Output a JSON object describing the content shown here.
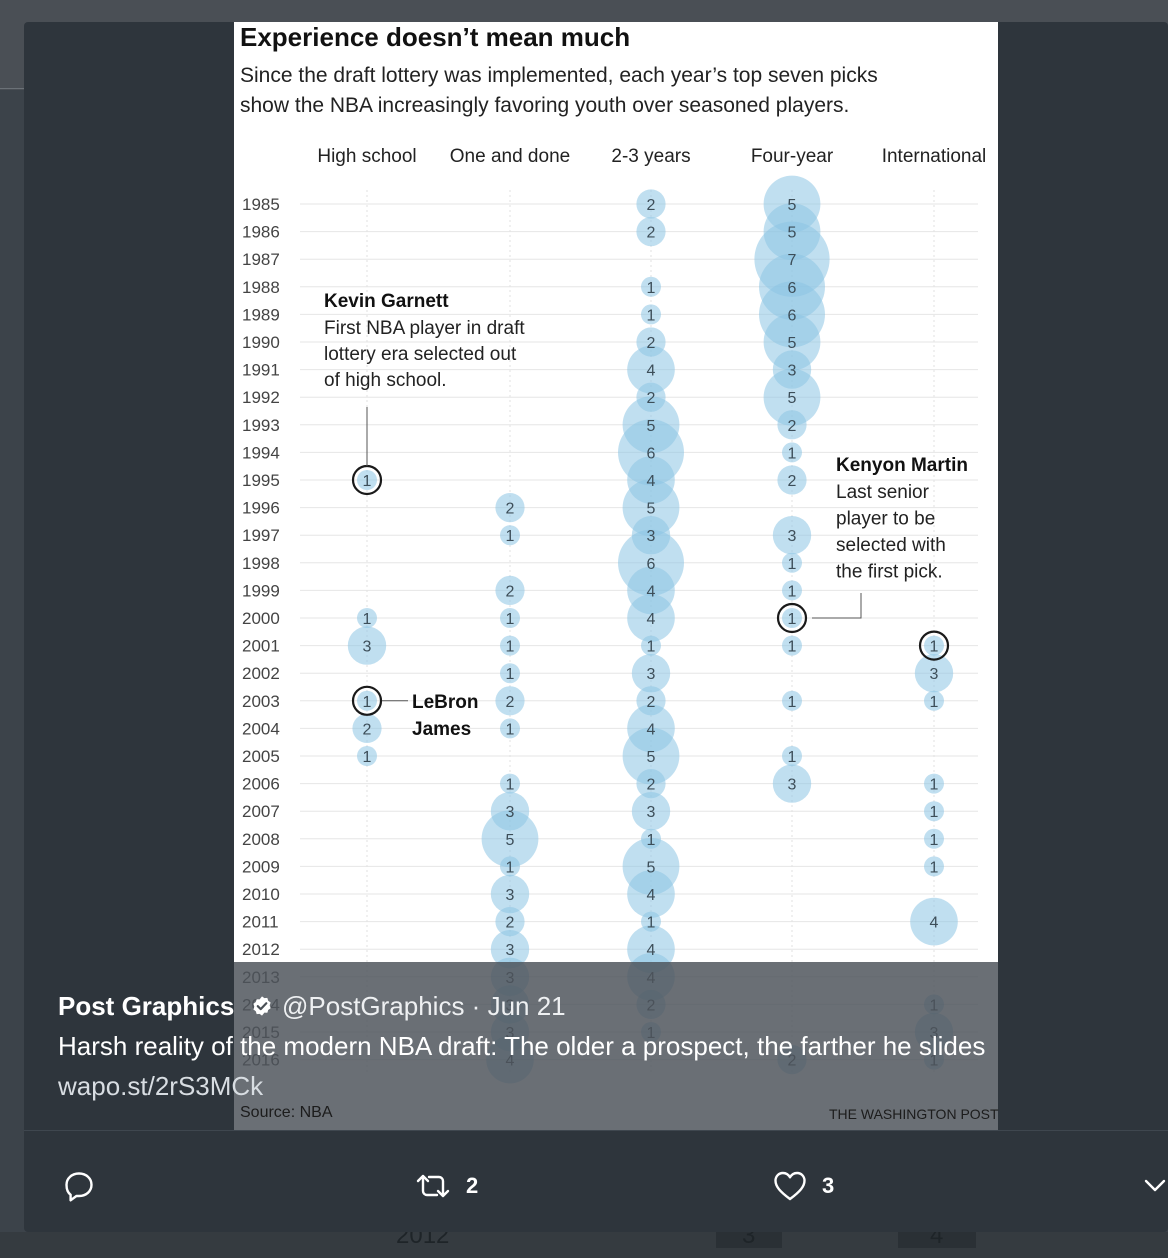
{
  "graphic": {
    "title": "Experience doesn’t mean much",
    "subtitle_line1": "Since the draft lottery was implemented, each year’s top seven picks",
    "subtitle_line2": "show the NBA increasingly favoring youth over seasoned players.",
    "source": "Source: NBA",
    "credit": "THE WASHINGTON POST"
  },
  "chart_data": {
    "type": "scatter",
    "title": "Experience doesn’t mean much",
    "subtitle": "Since the draft lottery was implemented, each year’s top seven picks show the NBA increasingly favoring youth over seasoned players.",
    "categories": [
      "High school",
      "One and done",
      "2-3 years",
      "Four-year",
      "International"
    ],
    "years": [
      1985,
      1986,
      1987,
      1988,
      1989,
      1990,
      1991,
      1992,
      1993,
      1994,
      1995,
      1996,
      1997,
      1998,
      1999,
      2000,
      2001,
      2002,
      2003,
      2004,
      2005,
      2006,
      2007,
      2008,
      2009,
      2010,
      2011,
      2012,
      2013,
      2014,
      2015,
      2016
    ],
    "series": [
      {
        "name": "High school",
        "values": [
          0,
          0,
          0,
          0,
          0,
          0,
          0,
          0,
          0,
          0,
          1,
          0,
          0,
          0,
          0,
          1,
          3,
          0,
          1,
          2,
          1,
          0,
          0,
          0,
          0,
          0,
          0,
          0,
          0,
          0,
          0,
          0
        ]
      },
      {
        "name": "One and done",
        "values": [
          0,
          0,
          0,
          0,
          0,
          0,
          0,
          0,
          0,
          0,
          0,
          2,
          1,
          0,
          2,
          1,
          1,
          1,
          2,
          1,
          0,
          1,
          3,
          5,
          1,
          3,
          2,
          3,
          3,
          3,
          3,
          4
        ]
      },
      {
        "name": "2-3 years",
        "values": [
          2,
          2,
          0,
          1,
          1,
          2,
          4,
          2,
          5,
          6,
          4,
          5,
          3,
          6,
          4,
          4,
          1,
          3,
          2,
          4,
          5,
          2,
          3,
          1,
          5,
          4,
          1,
          4,
          4,
          2,
          1,
          0
        ]
      },
      {
        "name": "Four-year",
        "values": [
          5,
          5,
          7,
          6,
          6,
          5,
          3,
          5,
          2,
          1,
          2,
          0,
          3,
          1,
          1,
          1,
          1,
          0,
          1,
          0,
          1,
          3,
          0,
          0,
          0,
          0,
          0,
          0,
          0,
          0,
          0,
          2
        ]
      },
      {
        "name": "International",
        "values": [
          0,
          0,
          0,
          0,
          0,
          0,
          0,
          0,
          0,
          0,
          0,
          0,
          0,
          0,
          0,
          0,
          1,
          3,
          1,
          0,
          0,
          1,
          1,
          1,
          1,
          0,
          4,
          0,
          0,
          1,
          3,
          1
        ]
      }
    ],
    "highlights": [
      {
        "column": "High school",
        "year": 1995,
        "value": 1
      },
      {
        "column": "High school",
        "year": 2003,
        "value": 1
      },
      {
        "column": "Four-year",
        "year": 2000,
        "value": 1
      },
      {
        "column": "International",
        "year": 2001,
        "value": 1
      }
    ],
    "annotations": [
      {
        "title": "Kevin Garnett",
        "lines": [
          "First NBA player in draft",
          "lottery era selected out",
          "of high school."
        ]
      },
      {
        "title_lines": [
          "LeBron",
          "James"
        ]
      },
      {
        "title": "Kenyon Martin",
        "lines": [
          "Last senior",
          "player to be",
          "selected with",
          "the first pick."
        ]
      }
    ],
    "colors": {
      "bubble": "#8cc4e3",
      "number": "#3d4e59",
      "highlight_ring": "#1a1a1a",
      "gridline": "#e6e6e6"
    }
  },
  "tweet": {
    "author_name": "Post Graphics",
    "handle_line": "@PostGraphics · Jun 21",
    "text": "Harsh reality of the modern NBA draft: The older a prospect, the farther he slides",
    "link": "wapo.st/2rS3MCk"
  },
  "actions": {
    "retweet_count": "2",
    "like_count": "3"
  },
  "background": {
    "ghost_year": "2012",
    "ghost_values": [
      "3",
      "4"
    ]
  },
  "icons": [
    "verified-badge-icon",
    "reply-icon",
    "retweet-icon",
    "like-icon",
    "chevron-down-icon"
  ]
}
